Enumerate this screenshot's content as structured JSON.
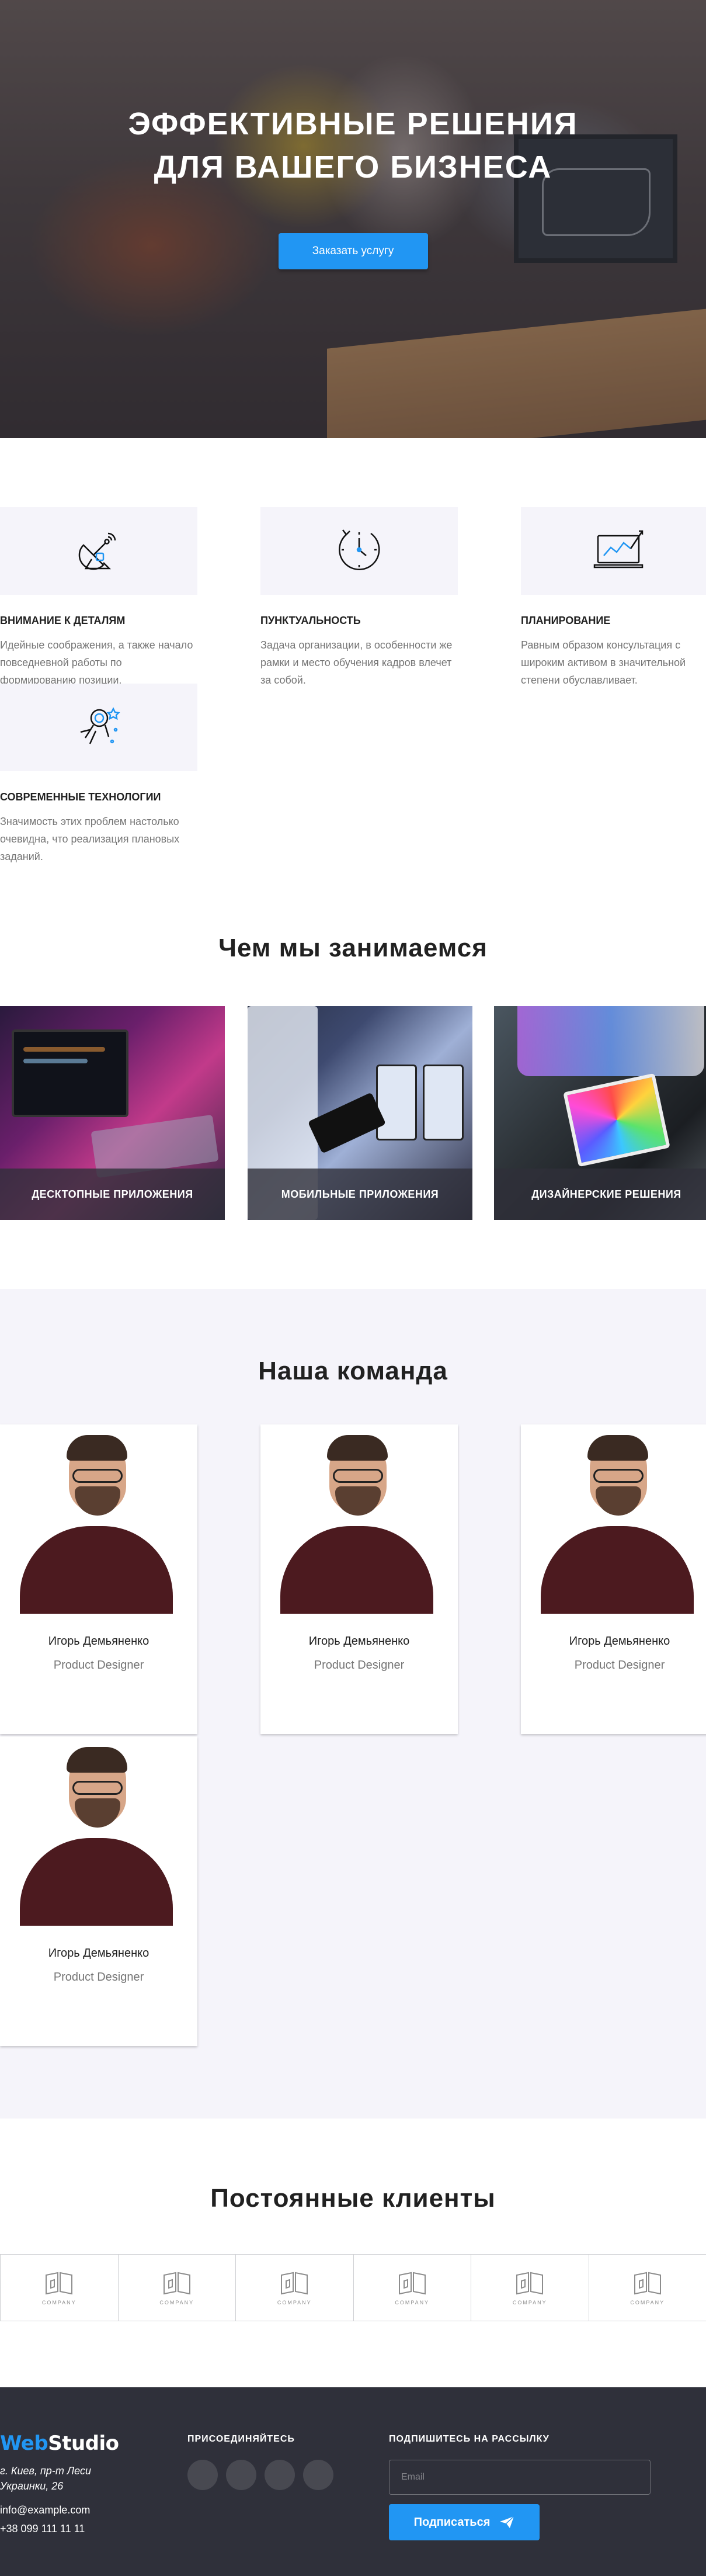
{
  "hero": {
    "title": "Эффективные решения для вашего бизнеса",
    "button": "Заказать услугу"
  },
  "features": [
    {
      "icon": "antenna-icon",
      "title": "Внимание к деталям",
      "text": "Идейные соображения, а также начало повседневной работы по формированию позиции."
    },
    {
      "icon": "clock-icon",
      "title": "Пунктуальность",
      "text": "Задача организации, в особенности же рамки и место обучения кадров влечет за собой."
    },
    {
      "icon": "chart-monitor-icon",
      "title": "Планирование",
      "text": "Равным образом консультация с широким активом в значительной степени обуславливает."
    },
    {
      "icon": "astronaut-icon",
      "title": "Современные технологии",
      "text": "Значимость этих проблем настолько очевидна, что реализация плановых заданий."
    }
  ],
  "services": {
    "title": "Чем мы занимаемся",
    "items": [
      {
        "label": "Десктопные приложения"
      },
      {
        "label": "Мобильные приложения"
      },
      {
        "label": "Дизайнерские решения"
      }
    ]
  },
  "team": {
    "title": "Наша команда",
    "members": [
      {
        "name": "Игорь Демьяненко",
        "role": "Product Designer"
      },
      {
        "name": "Игорь Демьяненко",
        "role": "Product Designer"
      },
      {
        "name": "Игорь Демьяненко",
        "role": "Product Designer"
      },
      {
        "name": "Игорь Демьяненко",
        "role": "Product Designer"
      }
    ]
  },
  "clients": {
    "title": "Постоянные клиенты",
    "logo_word": "COMPANY",
    "count": 6
  },
  "footer": {
    "logo_accent": "Web",
    "logo_rest": "Studio",
    "address": "г. Киев, пр-т Леси Украинки, 26",
    "email": "info@example.com",
    "phone": "+38 099 111 11 11",
    "join_title": "Присоединяйтесь",
    "subscribe_title": "Подпишитесь на рассылку",
    "email_placeholder": "Email",
    "subscribe_button": "Подписаться"
  },
  "colors": {
    "accent": "#2196f3",
    "dark": "#2f303a",
    "light_bg": "#f5f4fa"
  }
}
